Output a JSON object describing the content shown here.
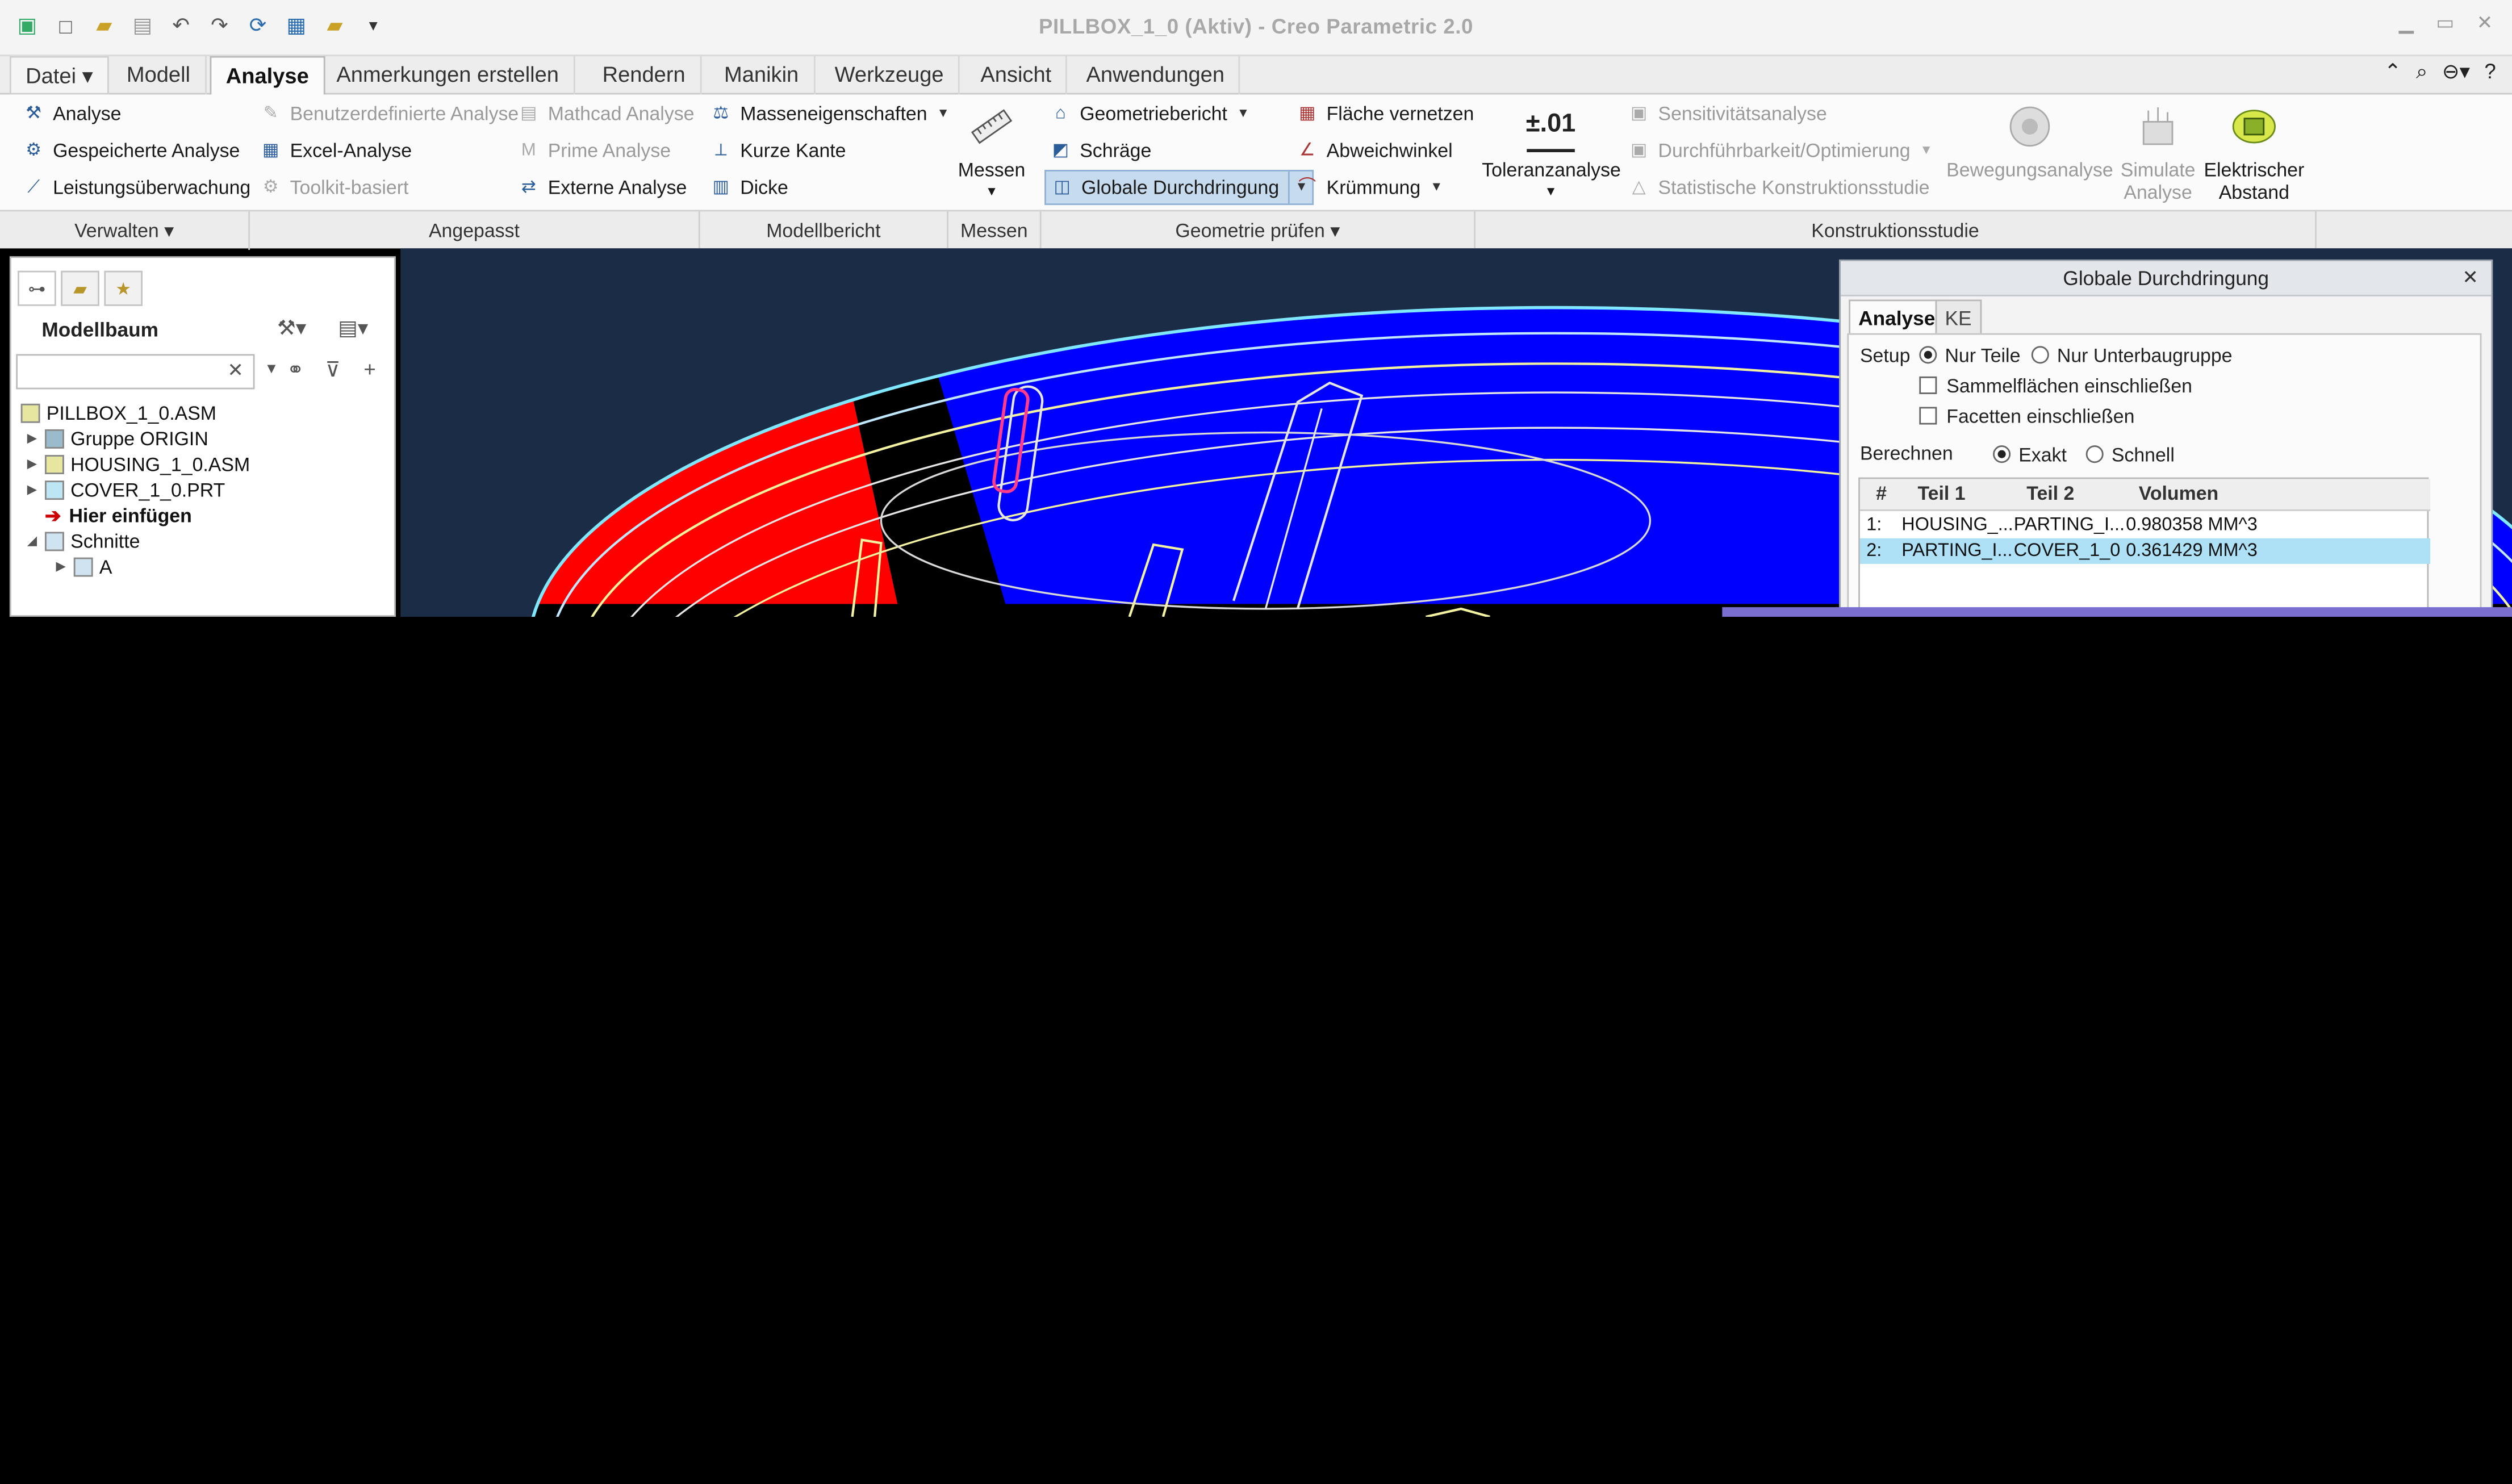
{
  "window": {
    "title": "PILLBOX_1_0 (Aktiv) - Creo Parametric 2.0",
    "controls": [
      "minimize-icon",
      "maximize-icon",
      "close-icon"
    ]
  },
  "tabs": [
    {
      "label": "Datei ▾"
    },
    {
      "label": "Modell"
    },
    {
      "label": "Analyse"
    },
    {
      "label": "Anmerkungen erstellen"
    },
    {
      "label": "Rendern"
    },
    {
      "label": "Manikin"
    },
    {
      "label": "Werkzeuge"
    },
    {
      "label": "Ansicht"
    },
    {
      "label": "Anwendungen"
    }
  ],
  "ribbon": {
    "verwalten": [
      "Analyse",
      "Gespeicherte Analyse",
      "Leistungsüberwachung"
    ],
    "angepasst": [
      "Benutzerdefinierte Analyse",
      "Excel-Analyse",
      "Toolkit-basiert",
      "Mathcad Analyse",
      "Prime Analyse",
      "Externe Analyse"
    ],
    "modellbericht": [
      "Masseneigenschaften",
      "Kurze Kante",
      "Dicke"
    ],
    "messen": "Messen",
    "geometrie": [
      "Geometriebericht",
      "Schräge",
      "Globale Durchdringung",
      "Fläche vernetzen",
      "Abweichwinkel",
      "Krümmung"
    ],
    "toleranz": {
      "icon_text": "±.01",
      "label": "Toleranzanalyse"
    },
    "studie": [
      "Sensitivitätsanalyse",
      "Durchführbarkeit/Optimierung",
      "Statistische Konstruktionsstudie"
    ],
    "big_buttons": [
      {
        "label_line1": "Bewegungsanalyse",
        "label_line2": ""
      },
      {
        "label_line1": "Simulate",
        "label_line2": "Analyse"
      },
      {
        "label_line1": "Elektrischer",
        "label_line2": "Abstand"
      }
    ],
    "groups": [
      "Verwalten ▾",
      "Angepasst",
      "Modellbericht",
      "Messen",
      "Geometrie prüfen ▾",
      "Konstruktionsstudie"
    ]
  },
  "navigator": {
    "title": "Modellbaum",
    "search_value": "",
    "tree": [
      {
        "label": "PILLBOX_1_0.ASM",
        "bold": false
      },
      {
        "label": "Gruppe ORIGIN",
        "bold": false
      },
      {
        "label": "HOUSING_1_0.ASM",
        "bold": false
      },
      {
        "label": "COVER_1_0.PRT",
        "bold": false
      },
      {
        "label": "Hier einfügen",
        "bold": true
      },
      {
        "label": "Schnitte",
        "bold": false
      },
      {
        "label": "A",
        "bold": false
      }
    ]
  },
  "dialog": {
    "title": "Globale Durchdringung",
    "tabs": [
      "Analyse",
      "KE"
    ],
    "setup_label": "Setup",
    "setup_options": [
      "Nur Teile",
      "Nur Unterbaugruppe"
    ],
    "checkboxes": [
      "Sammelflächen einschließen",
      "Facetten einschließen"
    ],
    "berechnen_label": "Berechnen",
    "berechnen_options": [
      "Exakt",
      "Schnell"
    ],
    "columns": [
      "#",
      "Teil 1",
      "Teil 2",
      "Volumen"
    ],
    "rows": [
      {
        "n": "1:",
        "t1": "HOUSING_...",
        "t2": "PARTING_I...",
        "vol": "0.980358 MM^3"
      },
      {
        "n": "2:",
        "t1": "PARTING_I...",
        "t2": "COVER_1_0",
        "vol": "0.361429 MM^3"
      }
    ]
  },
  "colors": {
    "viewport_bg": "#1b2c46",
    "selection": "#aee0f6",
    "red_zone": "#ff1010",
    "blue_zone": "#1010ff"
  }
}
